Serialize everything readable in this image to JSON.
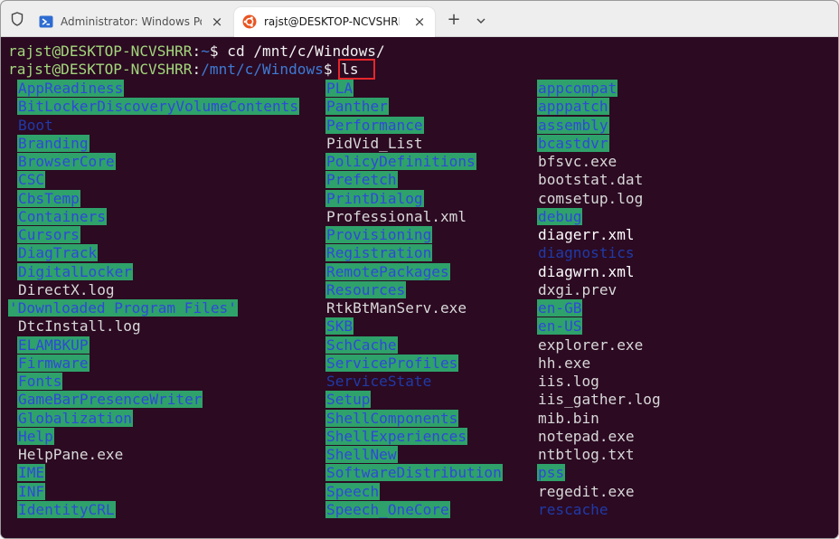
{
  "tabs": [
    {
      "icon": "powershell-icon",
      "title": "Administrator: Windows Power",
      "close": "×"
    },
    {
      "icon": "ubuntu-icon",
      "title": "rajst@DESKTOP-NCVSHRR: /m",
      "close": "×"
    }
  ],
  "tabbar": {
    "new_tab": "+"
  },
  "terminal": {
    "line1": {
      "user": "rajst@DESKTOP-NCVSHRR",
      "colon": ":",
      "path": "~",
      "dollar": "$",
      "cmd": " cd /mnt/c/Windows/"
    },
    "line2": {
      "user": "rajst@DESKTOP-NCVSHRR",
      "colon": ":",
      "path": "/mnt/c/Windows",
      "dollar": "$",
      "cmd": " ls"
    }
  },
  "listing": {
    "col1": [
      {
        "name": "AppReadiness",
        "type": "dirhl"
      },
      {
        "name": "BitLockerDiscoveryVolumeContents",
        "type": "dirhl"
      },
      {
        "name": "Boot",
        "type": "dir"
      },
      {
        "name": "Branding",
        "type": "dirhl"
      },
      {
        "name": "BrowserCore",
        "type": "dirhl"
      },
      {
        "name": "CSC",
        "type": "dirhl"
      },
      {
        "name": "CbsTemp",
        "type": "dirhl"
      },
      {
        "name": "Containers",
        "type": "dirhl"
      },
      {
        "name": "Cursors",
        "type": "dirhl"
      },
      {
        "name": "DiagTrack",
        "type": "dirhl"
      },
      {
        "name": "DigitalLocker",
        "type": "dirhl"
      },
      {
        "name": "DirectX.log",
        "type": "file"
      },
      {
        "name": "'Downloaded Program Files'",
        "type": "dirhl",
        "shift": true
      },
      {
        "name": "DtcInstall.log",
        "type": "file"
      },
      {
        "name": "ELAMBKUP",
        "type": "dirhl"
      },
      {
        "name": "Firmware",
        "type": "dirhl"
      },
      {
        "name": "Fonts",
        "type": "dirhl"
      },
      {
        "name": "GameBarPresenceWriter",
        "type": "dirhl"
      },
      {
        "name": "Globalization",
        "type": "dirhl"
      },
      {
        "name": "Help",
        "type": "dirhl"
      },
      {
        "name": "HelpPane.exe",
        "type": "file"
      },
      {
        "name": "IME",
        "type": "dirhl"
      },
      {
        "name": "INF",
        "type": "dirhl"
      },
      {
        "name": "IdentityCRL",
        "type": "dirhl"
      }
    ],
    "col2": [
      {
        "name": "PLA",
        "type": "dirhl"
      },
      {
        "name": "Panther",
        "type": "dirhl"
      },
      {
        "name": "Performance",
        "type": "dirhl"
      },
      {
        "name": "PidVid_List",
        "type": "file"
      },
      {
        "name": "PolicyDefinitions",
        "type": "dirhl"
      },
      {
        "name": "Prefetch",
        "type": "dirhl"
      },
      {
        "name": "PrintDialog",
        "type": "dirhl"
      },
      {
        "name": "Professional.xml",
        "type": "file"
      },
      {
        "name": "Provisioning",
        "type": "dirhl"
      },
      {
        "name": "Registration",
        "type": "dirhl"
      },
      {
        "name": "RemotePackages",
        "type": "dirhl"
      },
      {
        "name": "Resources",
        "type": "dirhl"
      },
      {
        "name": "RtkBtManServ.exe",
        "type": "file"
      },
      {
        "name": "SKB",
        "type": "dirhl"
      },
      {
        "name": "SchCache",
        "type": "dirhl"
      },
      {
        "name": "ServiceProfiles",
        "type": "dirhl"
      },
      {
        "name": "ServiceState",
        "type": "dir"
      },
      {
        "name": "Setup",
        "type": "dirhl"
      },
      {
        "name": "ShellComponents",
        "type": "dirhl"
      },
      {
        "name": "ShellExperiences",
        "type": "dirhl"
      },
      {
        "name": "ShellNew",
        "type": "dirhl"
      },
      {
        "name": "SoftwareDistribution",
        "type": "dirhl"
      },
      {
        "name": "Speech",
        "type": "dirhl"
      },
      {
        "name": "Speech_OneCore",
        "type": "dirhl"
      }
    ],
    "col3": [
      {
        "name": "appcompat",
        "type": "dirhl"
      },
      {
        "name": "apppatch",
        "type": "dirhl"
      },
      {
        "name": "assembly",
        "type": "dirhl"
      },
      {
        "name": "bcastdvr",
        "type": "dirhl"
      },
      {
        "name": "bfsvc.exe",
        "type": "file"
      },
      {
        "name": "bootstat.dat",
        "type": "file"
      },
      {
        "name": "comsetup.log",
        "type": "file"
      },
      {
        "name": "debug",
        "type": "dirhl"
      },
      {
        "name": "diagerr.xml",
        "type": "xml"
      },
      {
        "name": "diagnostics",
        "type": "dir"
      },
      {
        "name": "diagwrn.xml",
        "type": "xml"
      },
      {
        "name": "dxgi.prev",
        "type": "file"
      },
      {
        "name": "en-GB",
        "type": "dirhl"
      },
      {
        "name": "en-US",
        "type": "dirhl"
      },
      {
        "name": "explorer.exe",
        "type": "file"
      },
      {
        "name": "hh.exe",
        "type": "file"
      },
      {
        "name": "iis.log",
        "type": "file"
      },
      {
        "name": "iis_gather.log",
        "type": "file"
      },
      {
        "name": "mib.bin",
        "type": "file"
      },
      {
        "name": "notepad.exe",
        "type": "file"
      },
      {
        "name": "ntbtlog.txt",
        "type": "file"
      },
      {
        "name": "pss",
        "type": "dirhl"
      },
      {
        "name": "regedit.exe",
        "type": "file"
      },
      {
        "name": "rescache",
        "type": "dir"
      }
    ]
  }
}
